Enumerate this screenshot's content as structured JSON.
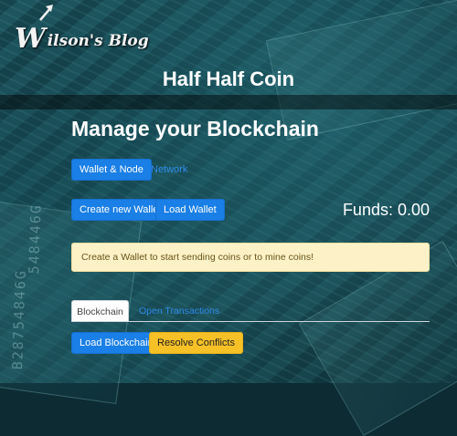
{
  "logo": {
    "initial": "W",
    "text": "ilson's Blog"
  },
  "navbar": {
    "title": "Half Half Coin"
  },
  "main": {
    "heading": "Manage your Blockchain",
    "top_tabs": [
      {
        "label": "Wallet & Node",
        "active": true
      },
      {
        "label": "Network",
        "active": false
      }
    ],
    "wallet_buttons": {
      "create": "Create new Wallet",
      "load": "Load Wallet"
    },
    "funds": "Funds: 0.00",
    "alert": "Create a Wallet to start sending coins or to mine coins!",
    "bottom_tabs": [
      {
        "label": "Blockchain",
        "active": true
      },
      {
        "label": "Open Transactions",
        "active": false
      }
    ],
    "chain_buttons": {
      "load": "Load Blockchain",
      "resolve": "Resolve Conflicts"
    }
  },
  "background": {
    "serials": [
      "B28754846G",
      "548446G"
    ]
  },
  "colors": {
    "primary": "#1a7fe6",
    "warning": "#f6c127",
    "alert_bg": "#fdf1c8",
    "link": "#2f8bea"
  }
}
